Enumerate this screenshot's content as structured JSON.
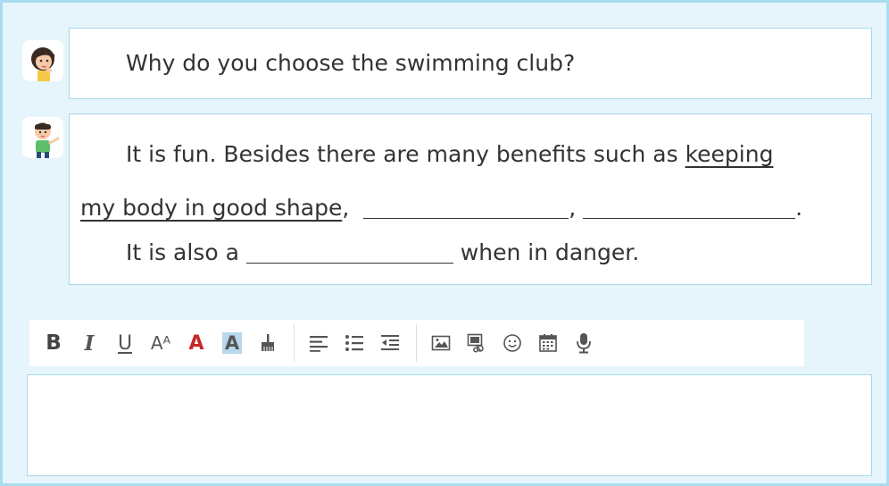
{
  "dialog": {
    "question": "Why do you choose the swimming club?",
    "answer": {
      "line1_text": "It is fun. Besides there are many benefits such as ",
      "line1_underlined": "keeping",
      "line2_underlined": "my body in good shape",
      "line2_comma1": ",",
      "line2_comma2": ",",
      "line2_period": ".",
      "line3_prefix": "It is also a ",
      "line3_suffix": " when in danger."
    }
  },
  "toolbar": {
    "bold": "B",
    "italic": "I",
    "underline": "U",
    "font_size": "Aᴬ",
    "font_color": "A",
    "highlight": "A",
    "colors": {
      "font_color": "#c62828",
      "highlight_bg": "#b7d7ee",
      "icon": "#555555"
    }
  },
  "editor": {
    "value": ""
  }
}
